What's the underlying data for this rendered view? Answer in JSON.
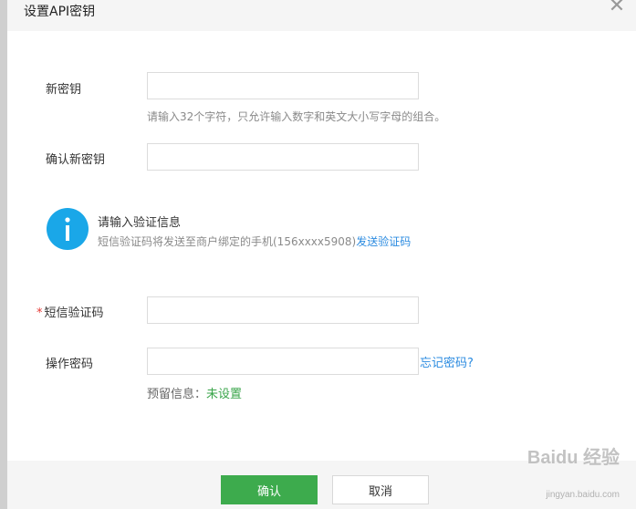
{
  "dialog": {
    "title": "设置API密钥",
    "close_icon": "close-icon"
  },
  "form": {
    "new_key_label": "新密钥",
    "new_key_value": "",
    "new_key_hint": "请输入32个字符，只允许输入数字和英文大小写字母的组合。",
    "confirm_key_label": "确认新密钥",
    "confirm_key_value": "",
    "sms_required_mark": "*",
    "sms_label": "短信验证码",
    "sms_value": "",
    "op_password_label": "操作密码",
    "op_password_value": "",
    "forgot_password": "忘记密码?",
    "reserved_info_label": "预留信息：",
    "reserved_info_value": "未设置"
  },
  "verify": {
    "icon": "info-icon",
    "title": "请输入验证信息",
    "desc": "短信验证码将发送至商户绑定的手机(156xxxx5908)",
    "send_link": "发送验证码"
  },
  "footer": {
    "confirm_button": "确认",
    "cancel_button": "取消"
  },
  "watermark": {
    "brand": "Baidu 经验",
    "url": "jingyan.baidu.com"
  },
  "colors": {
    "accent_green": "#3dab4d",
    "link_blue": "#2b8be0",
    "info_blue": "#1aa7e8",
    "required_red": "#e53935"
  }
}
